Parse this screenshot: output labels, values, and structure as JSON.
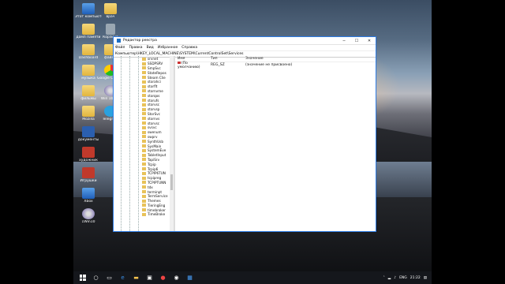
{
  "desktop": {
    "icons": [
      {
        "label": "Этот компьютер",
        "kind": "pc"
      },
      {
        "label": "врач",
        "kind": "folder"
      },
      {
        "label": "дамп памяти",
        "kind": "folder"
      },
      {
        "label": "Корзина",
        "kind": "bin"
      },
      {
        "label": "Dashboard",
        "kind": "folder"
      },
      {
        "label": "файлы",
        "kind": "folder"
      },
      {
        "label": "музыка",
        "kind": "folder"
      },
      {
        "label": "Google Chrome",
        "kind": "chrome"
      },
      {
        "label": "фильмы",
        "kind": "folder"
      },
      {
        "label": "Win 10 Pro",
        "kind": "dvd"
      },
      {
        "label": "Mozilla",
        "kind": "folder"
      },
      {
        "label": "Telegram",
        "kind": "tg"
      },
      {
        "label": "документы",
        "kind": "word"
      },
      {
        "label": "художник",
        "kind": "tile"
      },
      {
        "label": "Игрушки",
        "kind": "tile"
      },
      {
        "label": "Xbox",
        "kind": "pc"
      },
      {
        "label": "1Win10",
        "kind": "dvd"
      }
    ]
  },
  "regedit": {
    "title": "Редактор реестра",
    "controls": {
      "minimize": "─",
      "maximize": "☐",
      "close": "✕"
    },
    "menu": [
      "Файл",
      "Правка",
      "Вид",
      "Избранное",
      "Справка"
    ],
    "address": "Компьютер\\HKEY_LOCAL_MACHINE\\SYSTEM\\CurrentControlSet\\Services",
    "tree_items": [
      "srvnet",
      "SSDPSRV",
      "SmpSvc",
      "StateRepos",
      "Steam Clie",
      "storahci",
      "storflt",
      "stornvme",
      "storqos",
      "storufs",
      "storvsc",
      "storvsp",
      "StorSvc",
      "stornvs",
      "storvsc",
      "svsvc",
      "swenum",
      "swprv",
      "SynthUsb",
      "SysMain",
      "SystemEve",
      "TabletInput",
      "TapiSrv",
      "Tcpip",
      "Tcpip6",
      "TCPIP6TUN",
      "tcpipreg",
      "TCPIPTUNN",
      "tdx",
      "terminpt",
      "TermService",
      "Themes",
      "TieringEng",
      "timebroker",
      "TimeBroke"
    ],
    "columns": {
      "name": "Имя",
      "type": "Тип",
      "value": "Значение"
    },
    "values": [
      {
        "name": "(По умолчанию)",
        "type": "REG_SZ",
        "value": "(значение не присвоено)"
      }
    ]
  },
  "taskbar": {
    "lang": "ENG",
    "time": "21:22"
  }
}
